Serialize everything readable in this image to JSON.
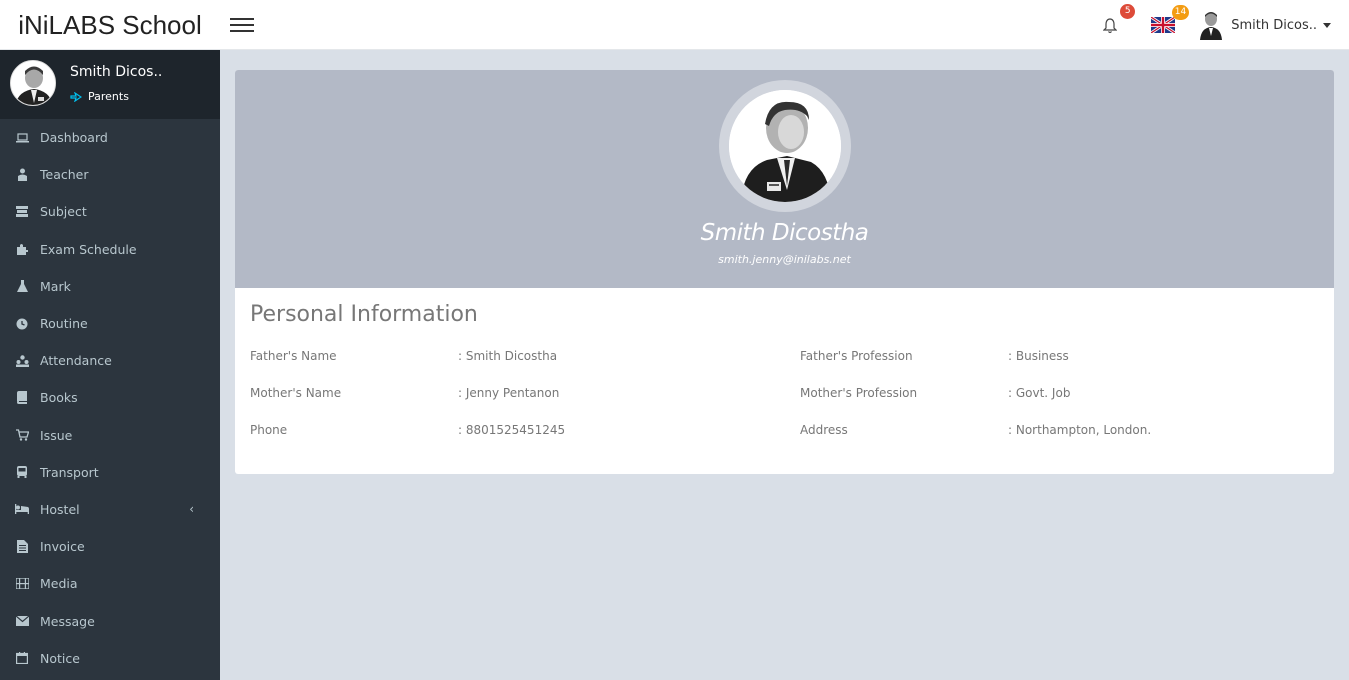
{
  "header": {
    "brand": "iNiLABS School",
    "notification_count": "5",
    "language_count": "14",
    "user_name": "Smith Dicos.."
  },
  "sidebar": {
    "user_name": "Smith Dicos..",
    "user_role": "Parents",
    "items": [
      {
        "label": "Dashboard",
        "icon": "laptop-icon"
      },
      {
        "label": "Teacher",
        "icon": "teacher-icon"
      },
      {
        "label": "Subject",
        "icon": "book-stack-icon"
      },
      {
        "label": "Exam Schedule",
        "icon": "puzzle-icon"
      },
      {
        "label": "Mark",
        "icon": "flask-icon"
      },
      {
        "label": "Routine",
        "icon": "clock-icon"
      },
      {
        "label": "Attendance",
        "icon": "sitemap-icon"
      },
      {
        "label": "Books",
        "icon": "books-icon"
      },
      {
        "label": "Issue",
        "icon": "cart-icon"
      },
      {
        "label": "Transport",
        "icon": "bus-icon"
      },
      {
        "label": "Hostel",
        "icon": "bed-icon"
      },
      {
        "label": "Invoice",
        "icon": "invoice-icon"
      },
      {
        "label": "Media",
        "icon": "film-icon"
      },
      {
        "label": "Message",
        "icon": "envelope-icon"
      },
      {
        "label": "Notice",
        "icon": "calendar-icon"
      }
    ]
  },
  "profile": {
    "name": "Smith Dicostha",
    "email": "smith.jenny@inilabs.net"
  },
  "info": {
    "title": "Personal Information",
    "left": [
      {
        "label": "Father's Name",
        "value": ": Smith Dicostha"
      },
      {
        "label": "Mother's Name",
        "value": ": Jenny Pentanon"
      },
      {
        "label": "Phone",
        "value": ": 8801525451245"
      }
    ],
    "right": [
      {
        "label": "Father's Profession",
        "value": ": Business"
      },
      {
        "label": "Mother's Profession",
        "value": ": Govt. Job"
      },
      {
        "label": "Address",
        "value": ": Northampton, London."
      }
    ]
  },
  "colors": {
    "sidebar_bg": "#2c353e",
    "banner_bg": "#b3b9c6",
    "page_bg": "#d9dfe7",
    "accent_teal": "#00c0ef"
  }
}
